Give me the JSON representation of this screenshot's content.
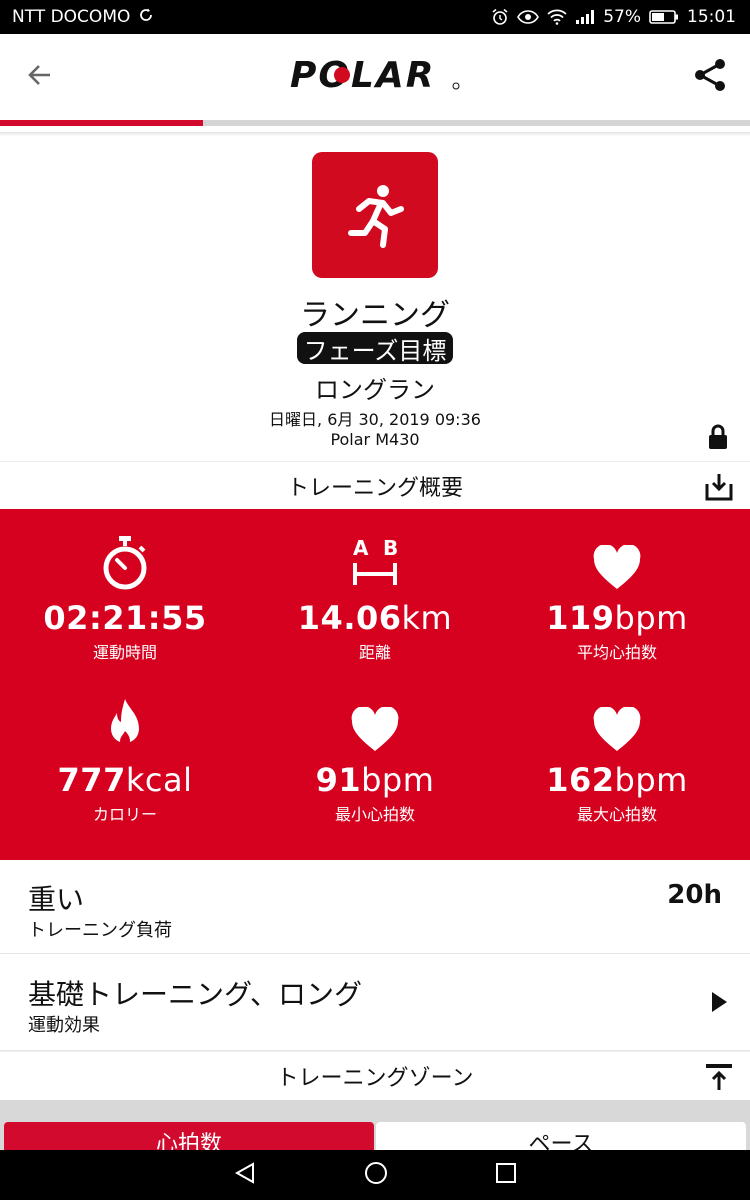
{
  "status_bar": {
    "carrier": "NTT DOCOMO",
    "battery": "57%",
    "time": "15:01"
  },
  "app_bar": {
    "logo_text": "POLAR"
  },
  "progress": {
    "fraction": 0.27
  },
  "session": {
    "sport": "ランニング",
    "phase_badge": "フェーズ目標",
    "target": "ロングラン",
    "datetime": "日曜日, 6月 30, 2019 09:36",
    "device": "Polar M430"
  },
  "summary": {
    "title": "トレーニング概要",
    "stats": [
      {
        "icon": "stopwatch-icon",
        "value": "02:21:55",
        "unit": "",
        "label": "運動時間"
      },
      {
        "icon": "distance-ab-icon",
        "value": "14.06",
        "unit": "km",
        "label": "距離"
      },
      {
        "icon": "heart-icon",
        "value": "119",
        "unit": "bpm",
        "label": "平均心拍数"
      },
      {
        "icon": "flame-icon",
        "value": "777",
        "unit": "kcal",
        "label": "カロリー"
      },
      {
        "icon": "heart-icon",
        "value": "91",
        "unit": "bpm",
        "label": "最小心拍数"
      },
      {
        "icon": "heart-icon",
        "value": "162",
        "unit": "bpm",
        "label": "最大心拍数"
      }
    ]
  },
  "training_load": {
    "title": "重い",
    "subtitle": "トレーニング負荷",
    "value": "20h"
  },
  "training_benefit": {
    "title": "基礎トレーニング、ロング",
    "subtitle": "運動効果"
  },
  "zones": {
    "title": "トレーニングゾーン",
    "tabs": [
      "心拍数",
      "ペース"
    ]
  },
  "colors": {
    "brand_red": "#d6001f",
    "tab_red": "#d10a2e"
  }
}
